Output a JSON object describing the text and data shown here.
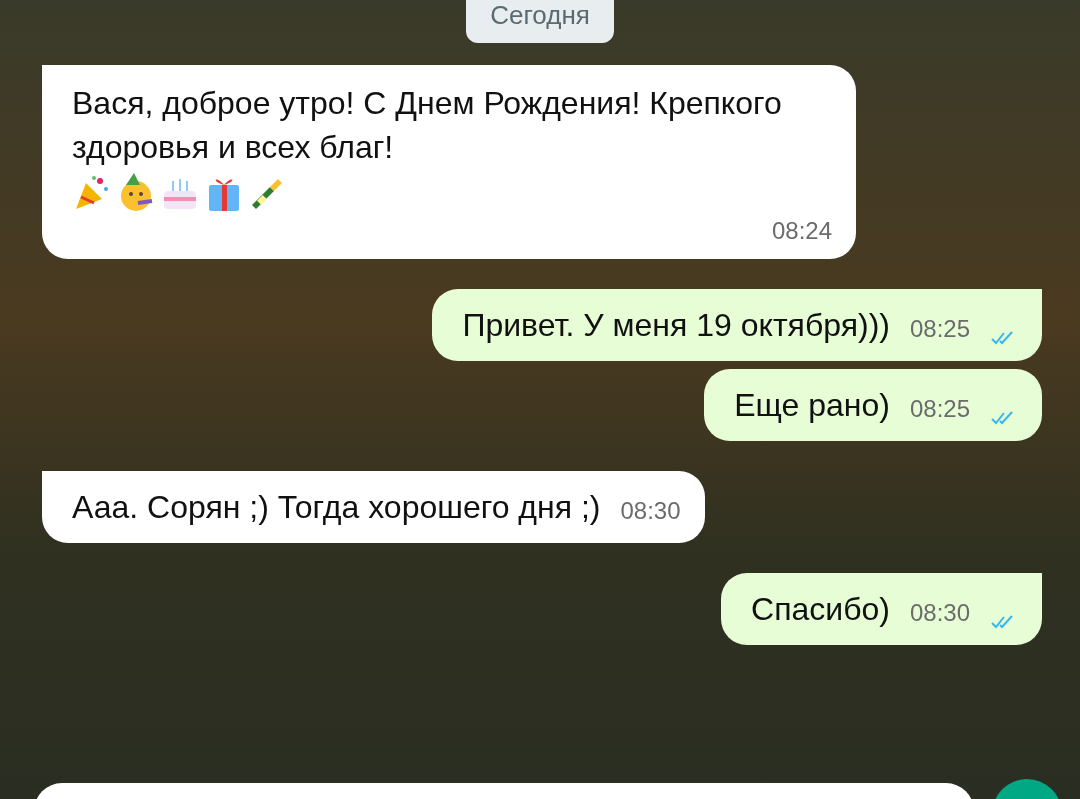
{
  "date_chip": "Сегодня",
  "messages": [
    {
      "kind": "incoming",
      "text": "Вася, доброе утро! С Днем Рождения! Крепкого здоровья и всех благ!",
      "stickers": [
        {
          "kind": "popper"
        },
        {
          "kind": "partyface"
        },
        {
          "kind": "cake"
        },
        {
          "kind": "gift"
        },
        {
          "kind": "champagne"
        }
      ],
      "time": "08:24",
      "tail": true
    },
    {
      "kind": "outgoing",
      "text": "Привет. У меня 19 октября)))",
      "time": "08:25",
      "read": true,
      "tail": true
    },
    {
      "kind": "outgoing",
      "text": "Еще рано)",
      "time": "08:25",
      "read": true,
      "tail": false
    },
    {
      "kind": "incoming",
      "text": "Ааа. Сорян ;) Тогда хорошего дня ;)",
      "time": "08:30",
      "tail": true
    },
    {
      "kind": "outgoing",
      "text": "Спасибо)",
      "time": "08:30",
      "read": true,
      "tail": true
    }
  ]
}
